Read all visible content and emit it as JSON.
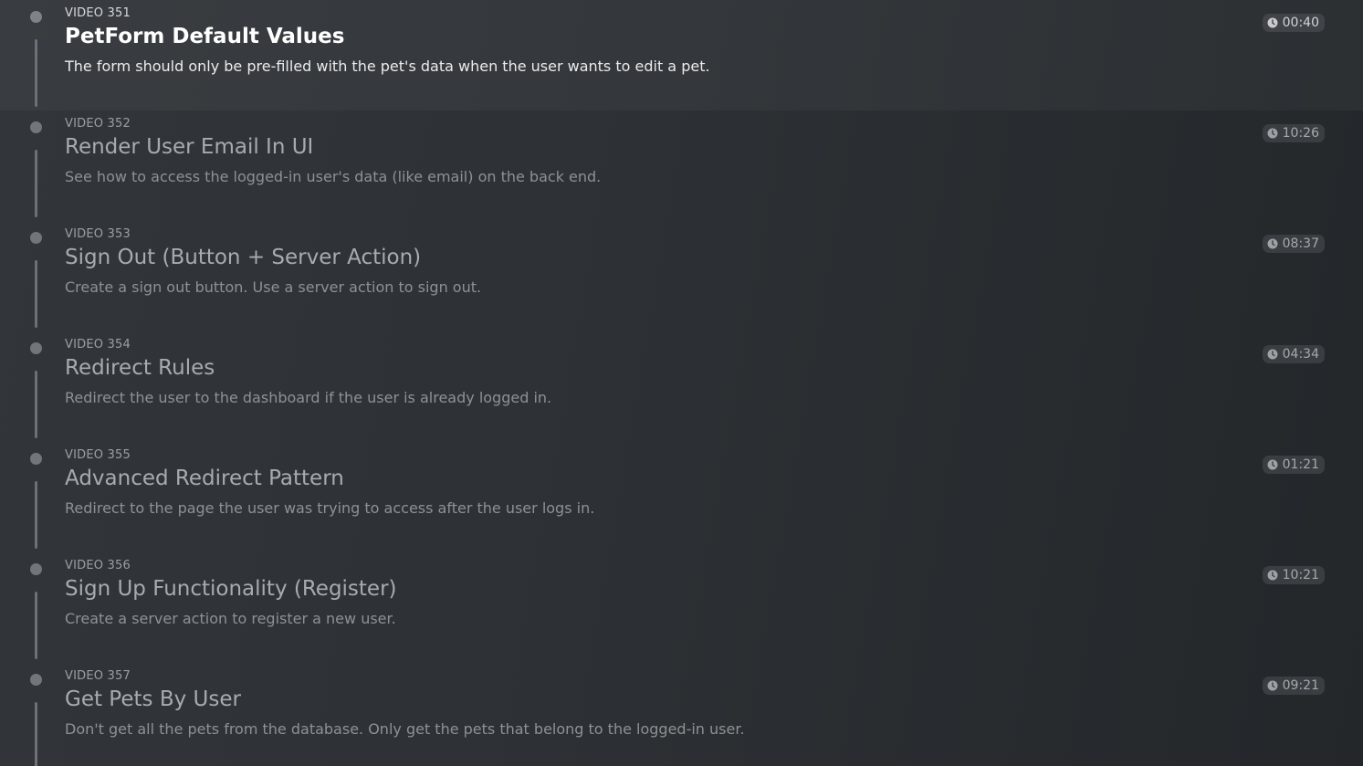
{
  "videos": [
    {
      "number": "VIDEO 351",
      "title": "PetForm Default Values",
      "description": "The form should only be pre-filled with the pet's data when the user wants to edit a pet.",
      "duration": "00:40",
      "active": true
    },
    {
      "number": "VIDEO 352",
      "title": "Render User Email In UI",
      "description": "See how to access the logged-in user's data (like email) on the back end.",
      "duration": "10:26",
      "active": false
    },
    {
      "number": "VIDEO 353",
      "title": "Sign Out (Button + Server Action)",
      "description": "Create a sign out button. Use a server action to sign out.",
      "duration": "08:37",
      "active": false
    },
    {
      "number": "VIDEO 354",
      "title": "Redirect Rules",
      "description": "Redirect the user to the dashboard if the user is already logged in.",
      "duration": "04:34",
      "active": false
    },
    {
      "number": "VIDEO 355",
      "title": "Advanced Redirect Pattern",
      "description": "Redirect to the page the user was trying to access after the user logs in.",
      "duration": "01:21",
      "active": false
    },
    {
      "number": "VIDEO 356",
      "title": "Sign Up Functionality (Register)",
      "description": "Create a server action to register a new user.",
      "duration": "10:21",
      "active": false
    },
    {
      "number": "VIDEO 357",
      "title": "Get Pets By User",
      "description": "Don't get all the pets from the database. Only get the pets that belong to the logged-in user.",
      "duration": "09:21",
      "active": false
    }
  ],
  "icons": {
    "duration": "clock-icon",
    "timeline": "timeline-dot"
  },
  "colors": {
    "background": "#2d3135",
    "active_title": "#ffffff",
    "inactive_title": "#a8abae",
    "timeline": "#6d7176"
  }
}
